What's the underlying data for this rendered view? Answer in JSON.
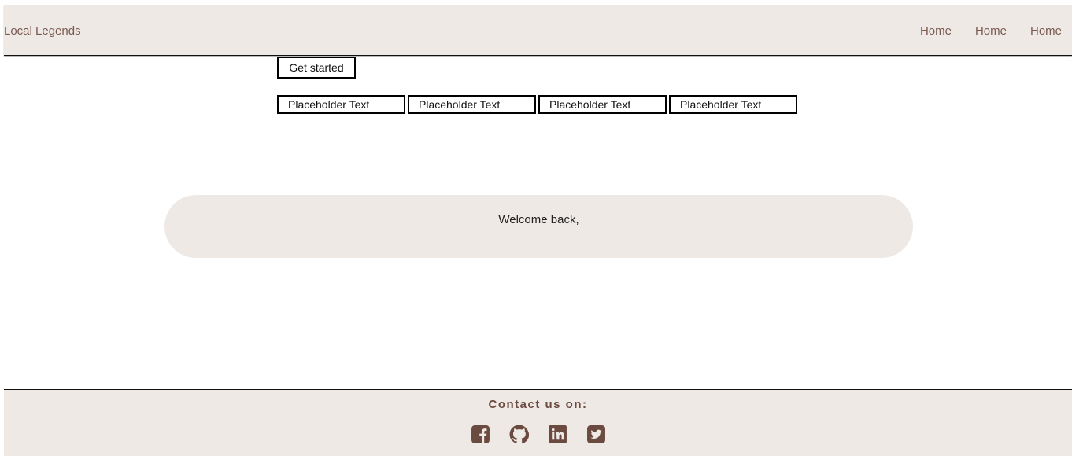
{
  "navbar": {
    "brand": "Local Legends",
    "links": [
      "Home",
      "Home",
      "Home"
    ]
  },
  "main": {
    "get_started_label": "Get started",
    "placeholders": [
      "Placeholder Text",
      "Placeholder Text",
      "Placeholder Text",
      "Placeholder Text"
    ],
    "welcome_text": "Welcome back,"
  },
  "footer": {
    "contact_label": "Contact us on:",
    "social_icons": [
      "facebook-icon",
      "github-icon",
      "linkedin-icon",
      "twitter-icon"
    ]
  },
  "colors": {
    "nav_background": "#efe9e6",
    "accent_brown": "#6b4a40",
    "link_brown": "#7a5a50"
  }
}
